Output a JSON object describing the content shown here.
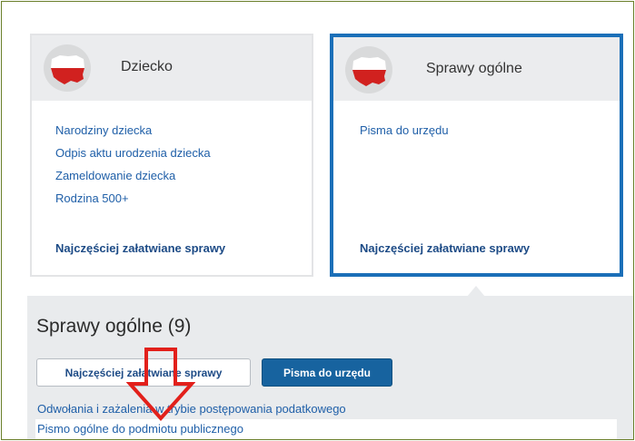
{
  "cards": [
    {
      "title": "Dziecko",
      "links": [
        "Narodziny dziecka",
        "Odpis aktu urodzenia dziecka",
        "Zameldowanie dziecka",
        "Rodzina 500+"
      ],
      "footer": "Najczęściej załatwiane sprawy",
      "icon": "poland-map-icon"
    },
    {
      "title": "Sprawy ogólne",
      "links": [
        "Pisma do urzędu"
      ],
      "footer": "Najczęściej załatwiane sprawy",
      "icon": "poland-map-icon",
      "selected": true
    }
  ],
  "panel": {
    "title": "Sprawy ogólne (9)",
    "buttons": [
      "Najczęściej załatwiane sprawy",
      "Pisma do urzędu"
    ],
    "active_button": "Pisma do urzędu",
    "items": [
      "Odwołania i zażalenia w trybie postępowania podatkowego",
      "Pismo ogólne do podmiotu publicznego"
    ]
  },
  "colors": {
    "selected_border": "#1b6fb8",
    "link": "#1f5fa8",
    "active_button": "#17639f",
    "annotation_arrow": "#e2201b"
  }
}
